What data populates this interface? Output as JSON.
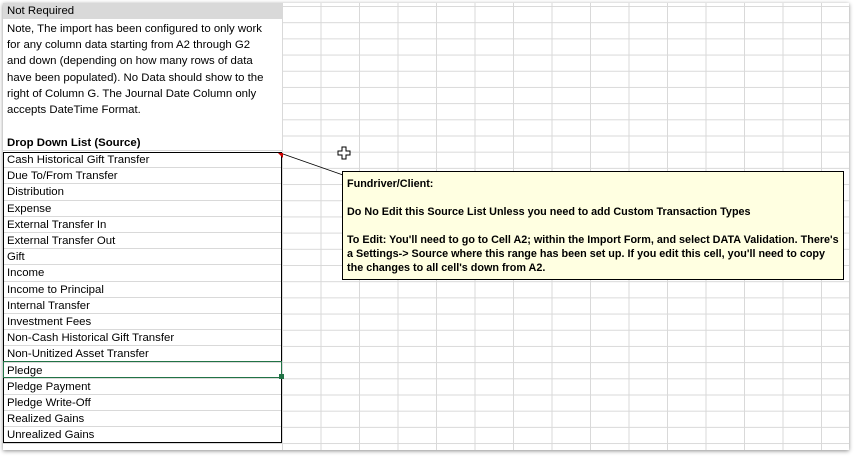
{
  "column_a": {
    "header_label": "Not Required",
    "note_lines": [
      "Note, The import has been configured to only work",
      "for any column data starting from A2 through G2",
      "and down (depending on how many rows of data",
      "have been populated). No Data should show to the",
      "right of Column G.  The Journal Date Column only",
      "accepts DateTime Format."
    ],
    "list_title": "Drop Down List (Source)",
    "list_items": [
      "Cash Historical Gift Transfer",
      "Due To/From Transfer",
      "Distribution",
      "Expense",
      "External Transfer In",
      "External Transfer Out",
      "Gift",
      "Income",
      "Income to Principal",
      "Internal Transfer",
      "Investment Fees",
      "Non-Cash Historical Gift Transfer",
      "Non-Unitized Asset Transfer",
      "Pledge",
      "Pledge Payment",
      "Pledge Write-Off",
      "Realized Gains",
      "Unrealized Gains"
    ],
    "selected_item": "Pledge"
  },
  "comment": {
    "author": "Fundriver/Client:",
    "line1": "Do No Edit this Source List Unless you need to add Custom Transaction Types",
    "line2": "To Edit: You'll need to go to Cell A2; within the Import Form, and select DATA Validation. There's a Settings-> Source where this range has been set up. If you edit this cell, you'll need to copy the changes to all cell's down from A2."
  },
  "colors": {
    "header_fill": "#d9d9d9",
    "comment_fill": "#ffffe1",
    "gridline": "#d9d9d9",
    "selection": "#217346",
    "comment_indicator": "#d00000"
  },
  "icons": {
    "cursor": "excel-cross-cursor-icon",
    "comment_indicator": "comment-indicator-icon"
  }
}
